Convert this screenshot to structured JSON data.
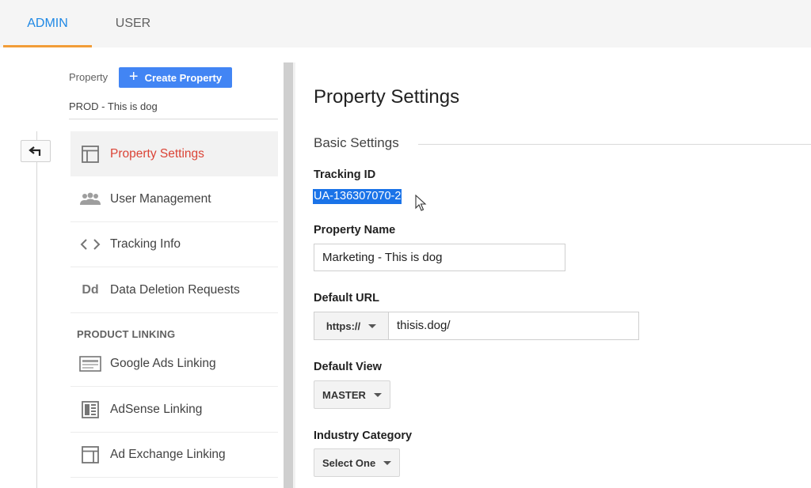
{
  "tabs": {
    "admin": "ADMIN",
    "user": "USER"
  },
  "sidebar": {
    "property_label": "Property",
    "create_button": "Create Property",
    "property_name": "PROD - This is dog",
    "items": [
      {
        "label": "Property Settings",
        "icon": "layout-icon"
      },
      {
        "label": "User Management",
        "icon": "people-icon"
      },
      {
        "label": "Tracking Info",
        "icon": "code-icon"
      },
      {
        "label": "Data Deletion Requests",
        "icon": "dd-icon"
      }
    ],
    "section_heading": "PRODUCT LINKING",
    "linking_items": [
      {
        "label": "Google Ads Linking",
        "icon": "ads-icon"
      },
      {
        "label": "AdSense Linking",
        "icon": "adsense-icon"
      },
      {
        "label": "Ad Exchange Linking",
        "icon": "adexchange-icon"
      }
    ]
  },
  "main": {
    "title": "Property Settings",
    "section": "Basic Settings",
    "tracking_id_label": "Tracking ID",
    "tracking_id": "UA-136307070-2",
    "property_name_label": "Property Name",
    "property_name_value": "Marketing - This is dog",
    "default_url_label": "Default URL",
    "url_protocol": "https://",
    "url_value": "thisis.dog/",
    "default_view_label": "Default View",
    "default_view_value": "MASTER",
    "industry_label": "Industry Category",
    "industry_value": "Select One"
  },
  "colors": {
    "accent_blue": "#4285f4",
    "active_red": "#db4437",
    "tab_underline": "#f29d38",
    "selection": "#1a73e8"
  },
  "icons": {
    "dd_icon_text": "Dd"
  }
}
